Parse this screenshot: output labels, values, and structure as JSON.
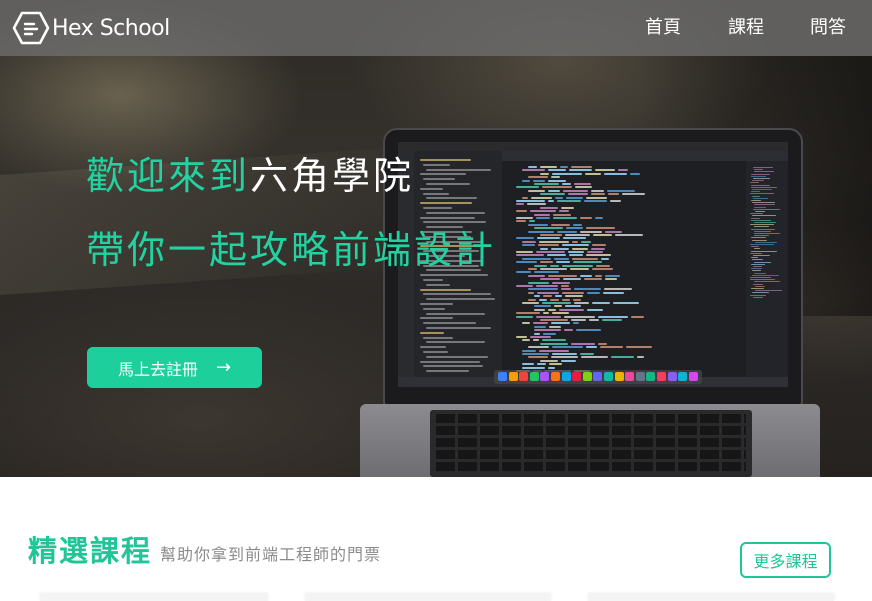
{
  "brand": {
    "name": "Hex School",
    "icon": "hexagon-logo-icon"
  },
  "nav": {
    "items": [
      {
        "label": "首頁"
      },
      {
        "label": "課程"
      },
      {
        "label": "問答"
      }
    ]
  },
  "hero": {
    "line1_accent": "歡迎來到",
    "line1_rest": "六角學院",
    "line2": "帶你一起攻略前端設計",
    "cta_label": "馬上去註冊",
    "cta_arrow": "→"
  },
  "featured": {
    "title": "精選課程",
    "subtitle": "幫助你拿到前端工程師的門票",
    "more_label": "更多課程"
  },
  "colors": {
    "accent": "#22d3a1",
    "button": "#1dcf9b",
    "section_accent": "#22c597",
    "navbar_bg": "#6e6e6e"
  }
}
